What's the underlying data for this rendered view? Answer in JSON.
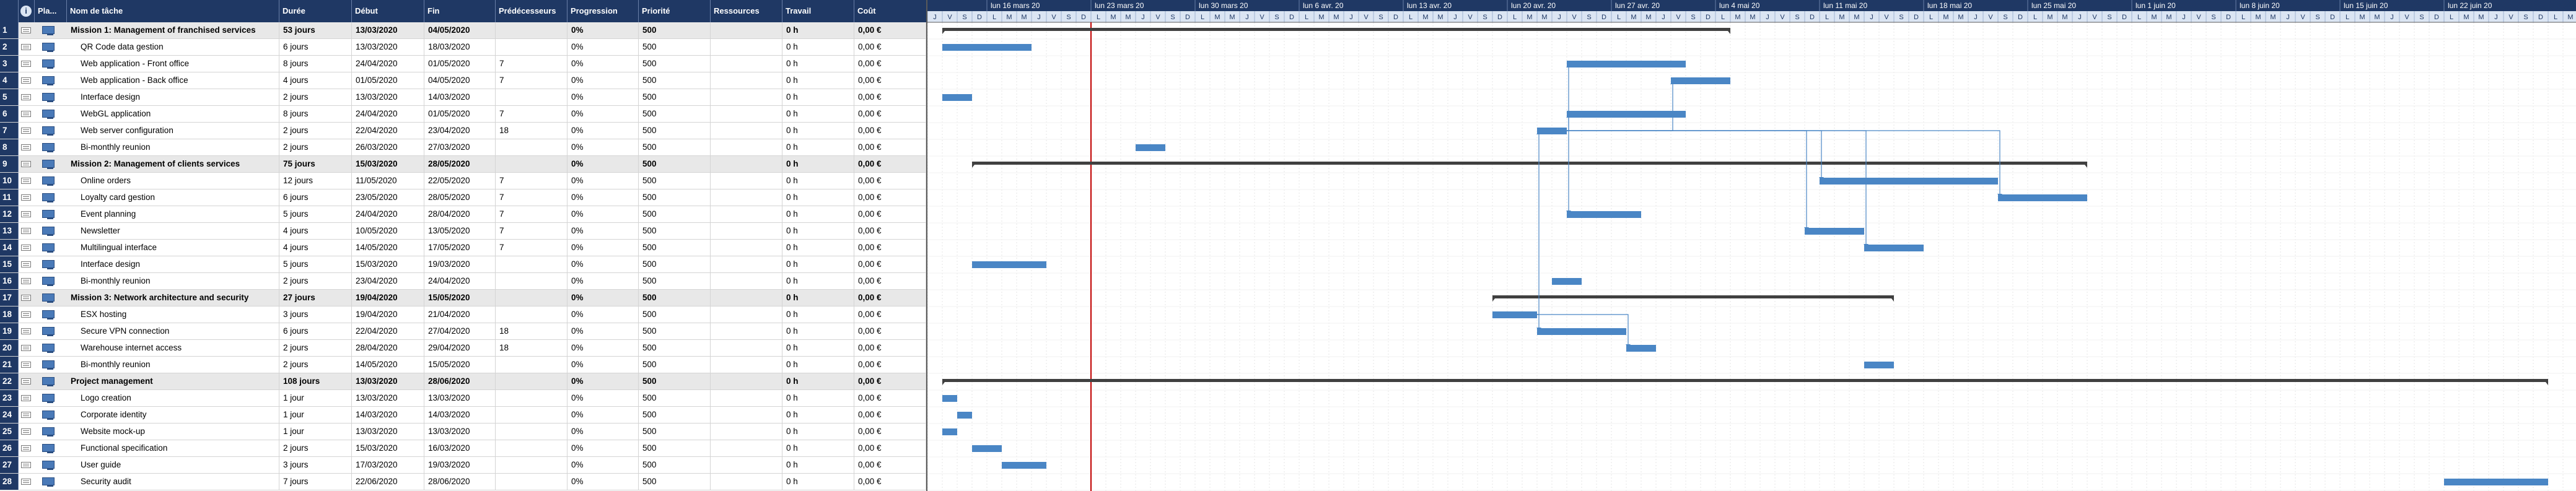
{
  "header": {
    "id": "",
    "info_icon": "info-icon",
    "mode": "Pla...",
    "name": "Nom de tâche",
    "duration": "Durée",
    "start": "Début",
    "end": "Fin",
    "predecessors": "Prédécesseurs",
    "progress": "Progression",
    "priority": "Priorité",
    "resources": "Ressources",
    "work": "Travail",
    "cost": "Coût"
  },
  "tasks": [
    {
      "id": "1",
      "name": "Mission 1: Management of franchised services",
      "summary": true,
      "duration": "53 jours",
      "start": "13/03/2020",
      "end": "04/05/2020",
      "pred": "",
      "progress": "0%",
      "priority": "500",
      "work": "0 h",
      "cost": "0,00 €",
      "bar_start": "2020-03-13",
      "bar_end": "2020-05-04"
    },
    {
      "id": "2",
      "name": "QR Code data gestion",
      "summary": false,
      "duration": "6 jours",
      "start": "13/03/2020",
      "end": "18/03/2020",
      "pred": "",
      "progress": "0%",
      "priority": "500",
      "work": "0 h",
      "cost": "0,00 €",
      "bar_start": "2020-03-13",
      "bar_end": "2020-03-18"
    },
    {
      "id": "3",
      "name": "Web application - Front office",
      "summary": false,
      "duration": "8 jours",
      "start": "24/04/2020",
      "end": "01/05/2020",
      "pred": "7",
      "progress": "0%",
      "priority": "500",
      "work": "0 h",
      "cost": "0,00 €",
      "bar_start": "2020-04-24",
      "bar_end": "2020-05-01"
    },
    {
      "id": "4",
      "name": "Web application - Back office",
      "summary": false,
      "duration": "4 jours",
      "start": "01/05/2020",
      "end": "04/05/2020",
      "pred": "7",
      "progress": "0%",
      "priority": "500",
      "work": "0 h",
      "cost": "0,00 €",
      "bar_start": "2020-05-01",
      "bar_end": "2020-05-04"
    },
    {
      "id": "5",
      "name": "Interface design",
      "summary": false,
      "duration": "2 jours",
      "start": "13/03/2020",
      "end": "14/03/2020",
      "pred": "",
      "progress": "0%",
      "priority": "500",
      "work": "0 h",
      "cost": "0,00 €",
      "bar_start": "2020-03-13",
      "bar_end": "2020-03-14"
    },
    {
      "id": "6",
      "name": "WebGL application",
      "summary": false,
      "duration": "8 jours",
      "start": "24/04/2020",
      "end": "01/05/2020",
      "pred": "7",
      "progress": "0%",
      "priority": "500",
      "work": "0 h",
      "cost": "0,00 €",
      "bar_start": "2020-04-24",
      "bar_end": "2020-05-01"
    },
    {
      "id": "7",
      "name": "Web server configuration",
      "summary": false,
      "duration": "2 jours",
      "start": "22/04/2020",
      "end": "23/04/2020",
      "pred": "18",
      "progress": "0%",
      "priority": "500",
      "work": "0 h",
      "cost": "0,00 €",
      "bar_start": "2020-04-22",
      "bar_end": "2020-04-23"
    },
    {
      "id": "8",
      "name": "Bi-monthly reunion",
      "summary": false,
      "duration": "2 jours",
      "start": "26/03/2020",
      "end": "27/03/2020",
      "pred": "",
      "progress": "0%",
      "priority": "500",
      "work": "0 h",
      "cost": "0,00 €",
      "bar_start": "2020-03-26",
      "bar_end": "2020-03-27"
    },
    {
      "id": "9",
      "name": "Mission 2: Management of clients services",
      "summary": true,
      "duration": "75 jours",
      "start": "15/03/2020",
      "end": "28/05/2020",
      "pred": "",
      "progress": "0%",
      "priority": "500",
      "work": "0 h",
      "cost": "0,00 €",
      "bar_start": "2020-03-15",
      "bar_end": "2020-05-28"
    },
    {
      "id": "10",
      "name": "Online orders",
      "summary": false,
      "duration": "12 jours",
      "start": "11/05/2020",
      "end": "22/05/2020",
      "pred": "7",
      "progress": "0%",
      "priority": "500",
      "work": "0 h",
      "cost": "0,00 €",
      "bar_start": "2020-05-11",
      "bar_end": "2020-05-22"
    },
    {
      "id": "11",
      "name": "Loyalty card gestion",
      "summary": false,
      "duration": "6 jours",
      "start": "23/05/2020",
      "end": "28/05/2020",
      "pred": "7",
      "progress": "0%",
      "priority": "500",
      "work": "0 h",
      "cost": "0,00 €",
      "bar_start": "2020-05-23",
      "bar_end": "2020-05-28"
    },
    {
      "id": "12",
      "name": "Event planning",
      "summary": false,
      "duration": "5 jours",
      "start": "24/04/2020",
      "end": "28/04/2020",
      "pred": "7",
      "progress": "0%",
      "priority": "500",
      "work": "0 h",
      "cost": "0,00 €",
      "bar_start": "2020-04-24",
      "bar_end": "2020-04-28"
    },
    {
      "id": "13",
      "name": "Newsletter",
      "summary": false,
      "duration": "4 jours",
      "start": "10/05/2020",
      "end": "13/05/2020",
      "pred": "7",
      "progress": "0%",
      "priority": "500",
      "work": "0 h",
      "cost": "0,00 €",
      "bar_start": "2020-05-10",
      "bar_end": "2020-05-13"
    },
    {
      "id": "14",
      "name": "Multilingual interface",
      "summary": false,
      "duration": "4 jours",
      "start": "14/05/2020",
      "end": "17/05/2020",
      "pred": "7",
      "progress": "0%",
      "priority": "500",
      "work": "0 h",
      "cost": "0,00 €",
      "bar_start": "2020-05-14",
      "bar_end": "2020-05-17"
    },
    {
      "id": "15",
      "name": "Interface design",
      "summary": false,
      "duration": "5 jours",
      "start": "15/03/2020",
      "end": "19/03/2020",
      "pred": "",
      "progress": "0%",
      "priority": "500",
      "work": "0 h",
      "cost": "0,00 €",
      "bar_start": "2020-03-15",
      "bar_end": "2020-03-19"
    },
    {
      "id": "16",
      "name": "Bi-monthly reunion",
      "summary": false,
      "duration": "2 jours",
      "start": "23/04/2020",
      "end": "24/04/2020",
      "pred": "",
      "progress": "0%",
      "priority": "500",
      "work": "0 h",
      "cost": "0,00 €",
      "bar_start": "2020-04-23",
      "bar_end": "2020-04-24"
    },
    {
      "id": "17",
      "name": "Mission 3: Network architecture and security",
      "summary": true,
      "duration": "27 jours",
      "start": "19/04/2020",
      "end": "15/05/2020",
      "pred": "",
      "progress": "0%",
      "priority": "500",
      "work": "0 h",
      "cost": "0,00 €",
      "bar_start": "2020-04-19",
      "bar_end": "2020-05-15"
    },
    {
      "id": "18",
      "name": "ESX hosting",
      "summary": false,
      "duration": "3 jours",
      "start": "19/04/2020",
      "end": "21/04/2020",
      "pred": "",
      "progress": "0%",
      "priority": "500",
      "work": "0 h",
      "cost": "0,00 €",
      "bar_start": "2020-04-19",
      "bar_end": "2020-04-21"
    },
    {
      "id": "19",
      "name": "Secure VPN connection",
      "summary": false,
      "duration": "6 jours",
      "start": "22/04/2020",
      "end": "27/04/2020",
      "pred": "18",
      "progress": "0%",
      "priority": "500",
      "work": "0 h",
      "cost": "0,00 €",
      "bar_start": "2020-04-22",
      "bar_end": "2020-04-27"
    },
    {
      "id": "20",
      "name": "Warehouse internet access",
      "summary": false,
      "duration": "2 jours",
      "start": "28/04/2020",
      "end": "29/04/2020",
      "pred": "18",
      "progress": "0%",
      "priority": "500",
      "work": "0 h",
      "cost": "0,00 €",
      "bar_start": "2020-04-28",
      "bar_end": "2020-04-29"
    },
    {
      "id": "21",
      "name": "Bi-monthly reunion",
      "summary": false,
      "duration": "2 jours",
      "start": "14/05/2020",
      "end": "15/05/2020",
      "pred": "",
      "progress": "0%",
      "priority": "500",
      "work": "0 h",
      "cost": "0,00 €",
      "bar_start": "2020-05-14",
      "bar_end": "2020-05-15"
    },
    {
      "id": "22",
      "name": "Project management",
      "summary": true,
      "duration": "108 jours",
      "start": "13/03/2020",
      "end": "28/06/2020",
      "pred": "",
      "progress": "0%",
      "priority": "500",
      "work": "0 h",
      "cost": "0,00 €",
      "bar_start": "2020-03-13",
      "bar_end": "2020-06-28"
    },
    {
      "id": "23",
      "name": "Logo creation",
      "summary": false,
      "duration": "1 jour",
      "start": "13/03/2020",
      "end": "13/03/2020",
      "pred": "",
      "progress": "0%",
      "priority": "500",
      "work": "0 h",
      "cost": "0,00 €",
      "bar_start": "2020-03-13",
      "bar_end": "2020-03-13"
    },
    {
      "id": "24",
      "name": "Corporate identity",
      "summary": false,
      "duration": "1 jour",
      "start": "14/03/2020",
      "end": "14/03/2020",
      "pred": "",
      "progress": "0%",
      "priority": "500",
      "work": "0 h",
      "cost": "0,00 €",
      "bar_start": "2020-03-14",
      "bar_end": "2020-03-14"
    },
    {
      "id": "25",
      "name": "Website mock-up",
      "summary": false,
      "duration": "1 jour",
      "start": "13/03/2020",
      "end": "13/03/2020",
      "pred": "",
      "progress": "0%",
      "priority": "500",
      "work": "0 h",
      "cost": "0,00 €",
      "bar_start": "2020-03-13",
      "bar_end": "2020-03-13"
    },
    {
      "id": "26",
      "name": "Functional specification",
      "summary": false,
      "duration": "2 jours",
      "start": "15/03/2020",
      "end": "16/03/2020",
      "pred": "",
      "progress": "0%",
      "priority": "500",
      "work": "0 h",
      "cost": "0,00 €",
      "bar_start": "2020-03-15",
      "bar_end": "2020-03-16"
    },
    {
      "id": "27",
      "name": "User guide",
      "summary": false,
      "duration": "3 jours",
      "start": "17/03/2020",
      "end": "19/03/2020",
      "pred": "",
      "progress": "0%",
      "priority": "500",
      "work": "0 h",
      "cost": "0,00 €",
      "bar_start": "2020-03-17",
      "bar_end": "2020-03-19"
    },
    {
      "id": "28",
      "name": "Security audit",
      "summary": false,
      "duration": "7 jours",
      "start": "22/06/2020",
      "end": "28/06/2020",
      "pred": "",
      "progress": "0%",
      "priority": "500",
      "work": "0 h",
      "cost": "0,00 €",
      "bar_start": "2020-06-22",
      "bar_end": "2020-06-28"
    }
  ],
  "timeline": {
    "start_date": "2020-03-12",
    "week_labels": [
      "lun 16 mars 20",
      "lun 23 mars 20",
      "lun 30 mars 20",
      "lun 6 avr. 20",
      "lun 13 avr. 20",
      "lun 20 avr. 20",
      "lun 27 avr. 20",
      "lun 4 mai 20",
      "lun 11 mai 20",
      "lun 18 mai 20",
      "lun 25 mai 20",
      "lun 1 juin 20",
      "lun 8 juin 20",
      "lun 15 juin 20",
      "lun 22 juin 20"
    ],
    "today_date": "2020-03-23",
    "colors": {
      "header_bg": "#1f3864",
      "summary_bar": "#404040",
      "task_bar": "#4a86c5",
      "today_line": "#c00000",
      "link_line": "#4a86c5"
    },
    "links": [
      {
        "from": "18",
        "to": "7"
      },
      {
        "from": "18",
        "to": "19"
      },
      {
        "from": "18",
        "to": "20"
      },
      {
        "from": "7",
        "to": "3"
      },
      {
        "from": "7",
        "to": "4"
      },
      {
        "from": "7",
        "to": "6"
      },
      {
        "from": "7",
        "to": "10"
      },
      {
        "from": "7",
        "to": "11"
      },
      {
        "from": "7",
        "to": "12"
      },
      {
        "from": "7",
        "to": "13"
      },
      {
        "from": "7",
        "to": "14"
      }
    ]
  }
}
